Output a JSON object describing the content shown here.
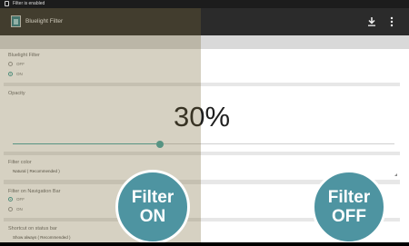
{
  "status_bar": {
    "notification_text": "Filter is enabled"
  },
  "app_bar": {
    "title": "Bluelight Filter",
    "actions": [
      {
        "icon": "download-icon"
      },
      {
        "icon": "more-vert-icon"
      }
    ]
  },
  "settings": {
    "bluelight_filter": {
      "title": "Bluelight Filter",
      "options": [
        {
          "label": "OFF",
          "selected": false
        },
        {
          "label": "ON",
          "selected": true
        }
      ]
    },
    "opacity": {
      "title": "Opacity",
      "value_text": "30%",
      "value": 30
    },
    "filter_color": {
      "title": "Filter color",
      "value": "Natural  ( Recommended )"
    },
    "filter_nav_bar": {
      "title": "Filter on Navigation Bar",
      "options": [
        {
          "label": "OFF",
          "selected": true
        },
        {
          "label": "ON",
          "selected": false
        }
      ]
    },
    "shortcut": {
      "title": "Shortcut on status bar",
      "value": "Show always  ( Recommended )"
    }
  },
  "promo": {
    "filter_on": {
      "line1": "Filter",
      "line2": "ON"
    },
    "filter_off": {
      "line1": "Filter",
      "line2": "OFF"
    }
  },
  "colors": {
    "accent": "#4aa8a5",
    "badge": "#4e94a1",
    "app_bar": "#2b2b2b",
    "filter_tint": "#786834"
  }
}
